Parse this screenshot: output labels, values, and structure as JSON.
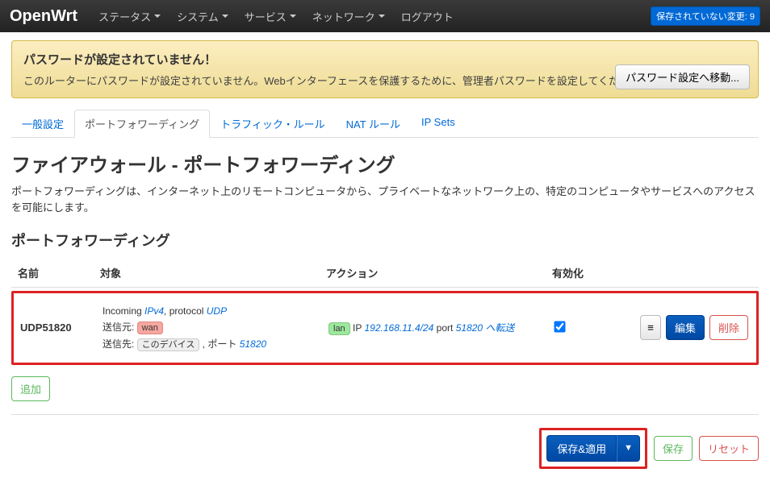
{
  "navbar": {
    "brand": "OpenWrt",
    "items": [
      "ステータス",
      "システム",
      "サービス",
      "ネットワーク",
      "ログアウト"
    ],
    "dropdowns": [
      true,
      true,
      true,
      true,
      false
    ],
    "changes_label": "保存されていない変更: 9"
  },
  "alert": {
    "title": "パスワードが設定されていません！",
    "body": "このルーターにパスワードが設定されていません。Webインターフェースを保護するために、管理者パスワードを設定してください。",
    "button": "パスワード設定へ移動..."
  },
  "tabs": {
    "items": [
      "一般設定",
      "ポートフォワーディング",
      "トラフィック・ルール",
      "NAT ルール",
      "IP Sets"
    ],
    "active_index": 1
  },
  "page": {
    "title": "ファイアウォール - ポートフォワーディング",
    "description": "ポートフォワーディングは、インターネット上のリモートコンピュータから、プライベートなネットワーク上の、特定のコンピュータやサービスへのアクセスを可能にします。"
  },
  "section": {
    "title": "ポートフォワーディング",
    "headers": {
      "name": "名前",
      "match": "対象",
      "action": "アクション",
      "enable": "有効化"
    }
  },
  "rule": {
    "name": "UDP51820",
    "incoming_prefix": "Incoming ",
    "incoming_ipv": "IPv4",
    "incoming_proto_prefix": ", protocol ",
    "incoming_proto": "UDP",
    "from_label": "送信元: ",
    "from_zone": "wan",
    "to_label": "送信先: ",
    "to_device": "このデバイス",
    "to_port_prefix": " , ポート ",
    "to_port": "51820",
    "action_zone": "lan",
    "action_ip_prefix": " IP ",
    "action_ip": "192.168.11.4/24",
    "action_port_prefix": " port ",
    "action_port": "51820",
    "action_suffix": " へ転送",
    "enabled": true
  },
  "buttons": {
    "hamburger": "≡",
    "edit": "編集",
    "delete": "削除",
    "add": "追加",
    "save_apply": "保存&適用",
    "caret": "▼",
    "save": "保存",
    "reset": "リセット"
  }
}
